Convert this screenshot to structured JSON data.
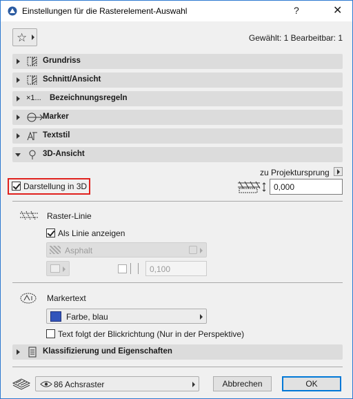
{
  "window": {
    "title": "Einstellungen für die Rasterelement-Auswahl",
    "help": "?",
    "close": "✕"
  },
  "header": {
    "selection_info": "Gewählt: 1 Bearbeitbar: 1"
  },
  "panels": [
    {
      "label": "Grundriss",
      "icon": "floorplan-icon"
    },
    {
      "label": "Schnitt/Ansicht",
      "icon": "section-icon"
    },
    {
      "label": "Bezeichnungsregeln",
      "icon": "naming-icon",
      "icon_text": "×1..."
    },
    {
      "label": "Marker",
      "icon": "marker-icon"
    },
    {
      "label": "Textstil",
      "icon": "textstyle-icon"
    },
    {
      "label": "3D-Ansicht",
      "icon": "3d-icon",
      "expanded": true
    }
  ],
  "view3d": {
    "display_3d": {
      "label": "Darstellung in 3D",
      "checked": true
    },
    "offset_label": "zu Projektursprung",
    "offset_value": "0,000"
  },
  "raster_line": {
    "title": "Raster-Linie",
    "show_as_line": {
      "label": "Als Linie anzeigen",
      "checked": true
    },
    "material": "Asphalt",
    "thickness": "0,100"
  },
  "marker_text": {
    "title": "Markertext",
    "color": "Farbe, blau",
    "color_hex": "#3355bb",
    "follow_view": {
      "label": "Text folgt der Blickrichtung (Nur in der Perspektive)",
      "checked": false
    }
  },
  "classification_panel": {
    "label": "Klassifizierung und Eigenschaften"
  },
  "footer": {
    "layer": "86 Achsraster",
    "cancel": "Abbrechen",
    "ok": "OK"
  }
}
